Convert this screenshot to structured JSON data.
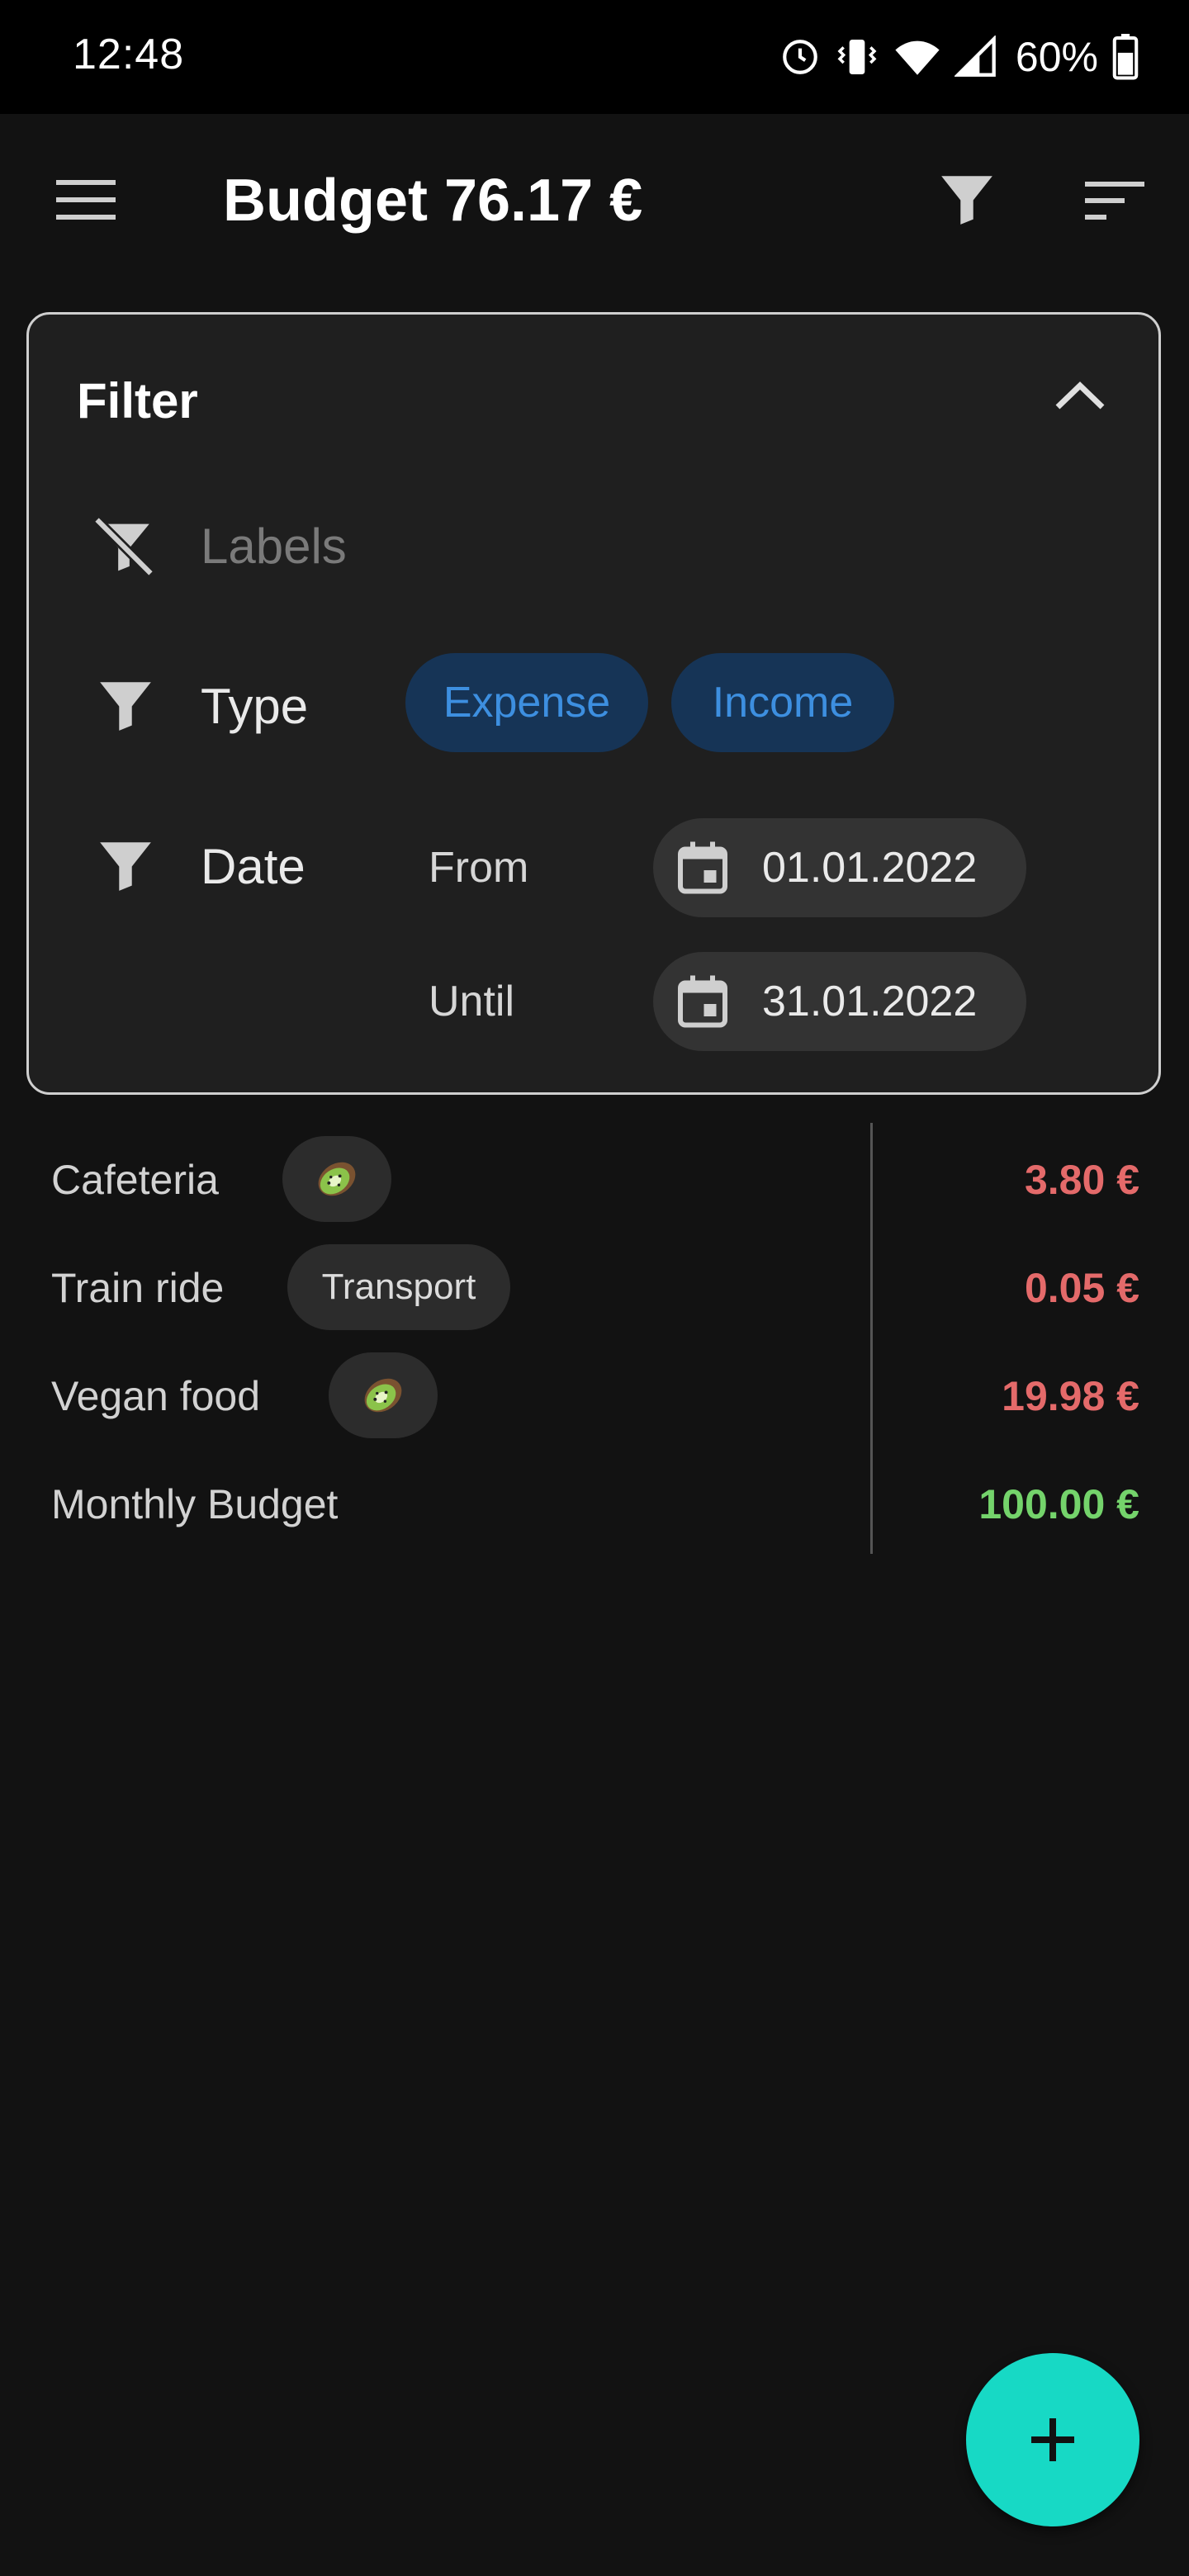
{
  "status_bar": {
    "time": "12:48",
    "battery_percent": "60%",
    "icons": [
      "sync-icon",
      "vibrate-icon",
      "wifi-icon",
      "signal-icon",
      "battery-icon"
    ]
  },
  "app_bar": {
    "title": "Budget 76.17 €",
    "icons": [
      "menu-icon",
      "filter-icon",
      "sort-icon"
    ]
  },
  "filter": {
    "title": "Filter",
    "labels_placeholder": "Labels",
    "type_label": "Type",
    "type_chips": [
      "Expense",
      "Income"
    ],
    "date_label": "Date",
    "from_label": "From",
    "from_value": "01.01.2022",
    "until_label": "Until",
    "until_value": "31.01.2022"
  },
  "transactions": [
    {
      "name": "Cafeteria",
      "tag_icon": "kiwi-icon",
      "amount": "3.80 €",
      "kind": "expense"
    },
    {
      "name": "Train ride",
      "tag": "Transport",
      "amount": "0.05 €",
      "kind": "expense"
    },
    {
      "name": "Vegan food",
      "tag_icon": "kiwi-icon",
      "amount": "19.98 €",
      "kind": "expense"
    },
    {
      "name": "Monthly Budget",
      "amount": "100.00 €",
      "kind": "income"
    }
  ],
  "colors": {
    "background": "#121212",
    "card": "#1f1f1f",
    "chip_selected_bg": "#163456",
    "chip_selected_text": "#3d8fe0",
    "expense": "#e46a6a",
    "income": "#74d36b",
    "fab": "#17d9c5"
  }
}
